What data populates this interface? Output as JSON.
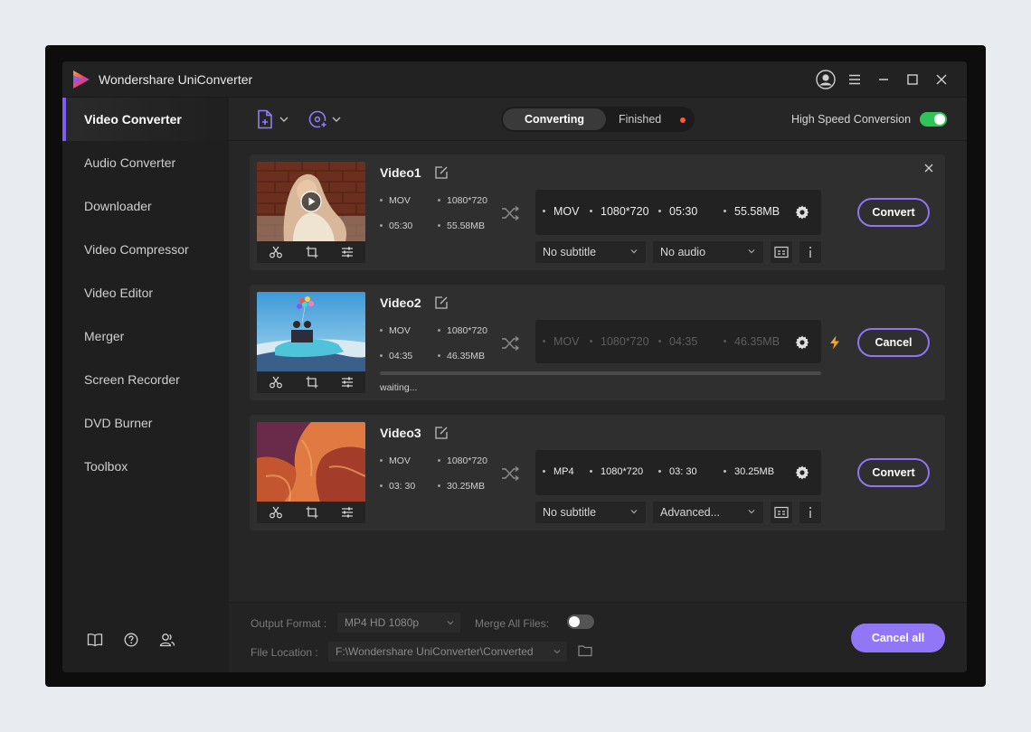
{
  "app": {
    "title": "Wondershare UniConverter"
  },
  "titlebar": {
    "icons": [
      "user-avatar-icon",
      "menu-icon",
      "minimize-icon",
      "maximize-icon",
      "close-icon"
    ]
  },
  "sidebar": {
    "items": [
      {
        "label": "Video Converter",
        "active": true
      },
      {
        "label": "Audio Converter"
      },
      {
        "label": "Downloader"
      },
      {
        "label": "Video Compressor"
      },
      {
        "label": "Video Editor"
      },
      {
        "label": "Merger"
      },
      {
        "label": "Screen Recorder"
      },
      {
        "label": "DVD Burner"
      },
      {
        "label": "Toolbox"
      }
    ],
    "bottom_icons": [
      "book-icon",
      "help-icon",
      "account-icon"
    ]
  },
  "toolbar": {
    "tabs": [
      {
        "label": "Converting",
        "active": true
      },
      {
        "label": "Finished"
      }
    ],
    "finished_dot_color": "#ff5a36",
    "high_speed_label": "High Speed Conversion",
    "high_speed_on": true
  },
  "files": [
    {
      "name": "Video1",
      "src": {
        "format": "MOV",
        "resolution": "1080*720",
        "duration": "05:30",
        "size": "55.58MB"
      },
      "out": {
        "format": "MOV",
        "resolution": "1080*720",
        "duration": "05:30",
        "size": "55.58MB"
      },
      "subtitle": "No subtitle",
      "audio": "No audio",
      "action": "Convert"
    },
    {
      "name": "Video2",
      "src": {
        "format": "MOV",
        "resolution": "1080*720",
        "duration": "04:35",
        "size": "46.35MB"
      },
      "out": {
        "format": "MOV",
        "resolution": "1080*720",
        "duration": "04:35",
        "size": "46.35MB"
      },
      "status": "waiting...",
      "progress": 0,
      "action": "Cancel"
    },
    {
      "name": "Video3",
      "src": {
        "format": "MOV",
        "resolution": "1080*720",
        "duration": "03: 30",
        "size": "30.25MB"
      },
      "out": {
        "format": "MP4",
        "resolution": "1080*720",
        "duration": "03: 30",
        "size": "30.25MB"
      },
      "subtitle": "No subtitle",
      "audio": "Advanced...",
      "action": "Convert"
    }
  ],
  "footer": {
    "output_format_label": "Output Format :",
    "output_format_value": "MP4 HD 1080p",
    "merge_label": "Merge All Files:",
    "merge_on": false,
    "file_location_label": "File Location :",
    "file_location_value": "F:\\Wondershare UniConverter\\Converted",
    "cancel_all_label": "Cancel all"
  },
  "colors": {
    "accent": "#8f74f5",
    "toggle_on": "#2ec45a",
    "warning": "#f5a623"
  }
}
